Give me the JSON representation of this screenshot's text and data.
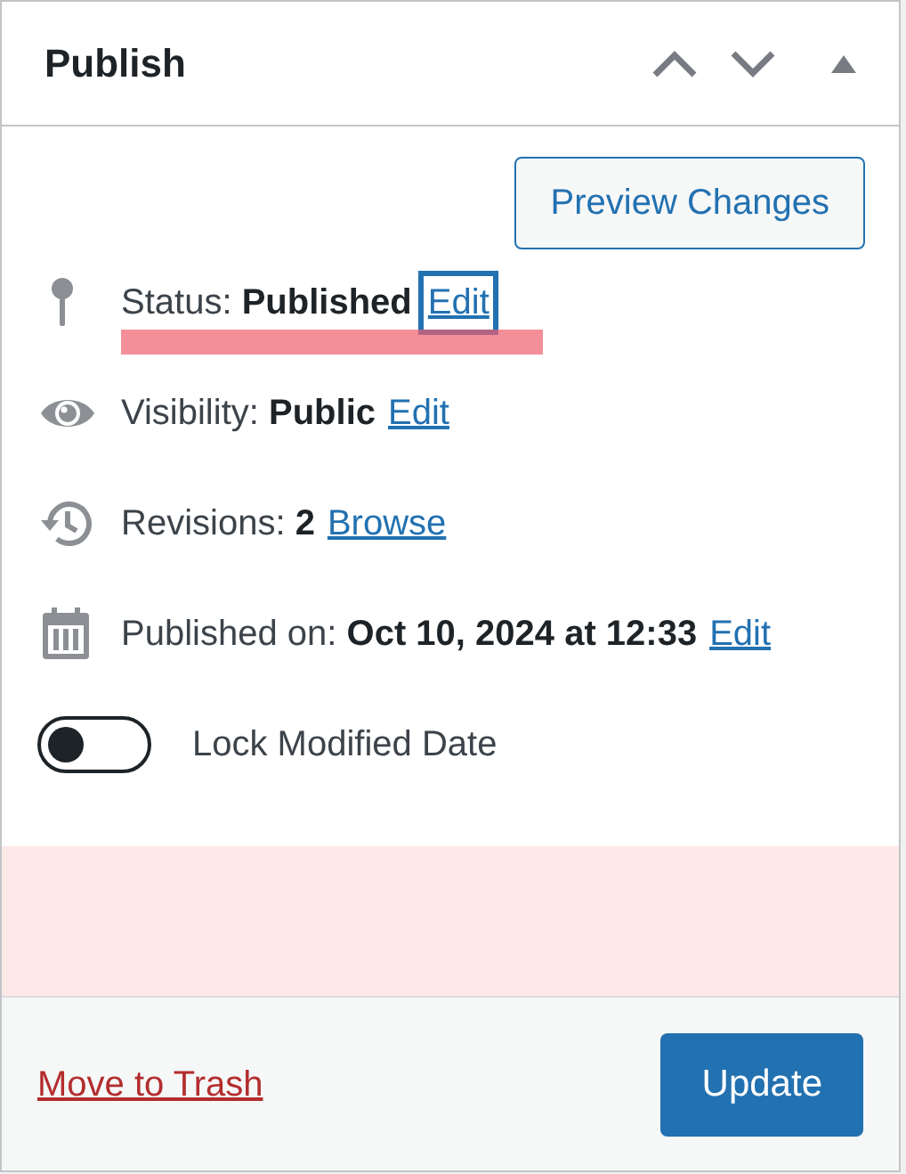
{
  "panel": {
    "title": "Publish"
  },
  "preview_button": "Preview Changes",
  "rows": [
    {
      "kind": "status",
      "label": "Status:",
      "value": "Published",
      "link": "Edit",
      "focused": true,
      "highlighted": true
    },
    {
      "kind": "visibility",
      "label": "Visibility:",
      "value": "Public",
      "link": "Edit",
      "focused": false,
      "highlighted": false
    },
    {
      "kind": "revisions",
      "label": "Revisions:",
      "value": "2",
      "link": "Browse",
      "focused": false,
      "highlighted": false
    },
    {
      "kind": "date",
      "label": "Published on:",
      "value": "Oct 10, 2024 at 12:33",
      "link": "Edit",
      "focused": false,
      "highlighted": false
    }
  ],
  "toggle": {
    "label": "Lock Modified Date",
    "on": false
  },
  "footer": {
    "trash_link": "Move to Trash",
    "update_button": "Update"
  }
}
